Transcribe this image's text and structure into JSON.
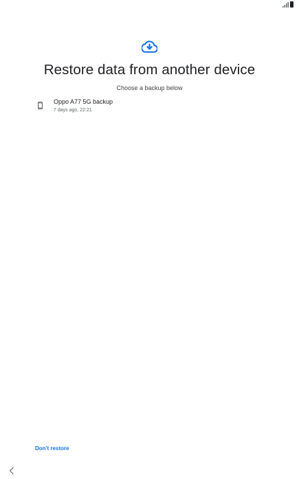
{
  "status_bar": {
    "signal_icon": "signal-icon",
    "battery_icon": "battery-icon"
  },
  "header": {
    "icon": "cloud-download-icon",
    "title": "Restore data from another device",
    "subtitle": "Choose a backup below"
  },
  "backups": [
    {
      "icon": "phone-icon",
      "name": "Oppo A77 5G backup",
      "meta": "7 days ago, 22:21"
    }
  ],
  "footer": {
    "dont_restore_label": "Don't restore"
  },
  "nav": {
    "back_icon": "back-chevron-icon"
  },
  "colors": {
    "accent": "#1a73e8",
    "text": "#202124",
    "secondary_text": "#5f6368"
  }
}
